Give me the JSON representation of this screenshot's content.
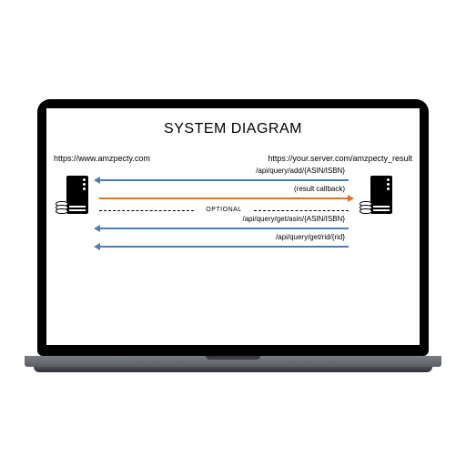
{
  "title": "SYSTEM DIAGRAM",
  "endpoints": {
    "left": "https://www.amzpecty.com",
    "right": "https://your.server.com/amzpecty_result"
  },
  "arrows": {
    "add": {
      "label": "/api/query/add/{ASIN/ISBN}",
      "direction": "left",
      "color": "blue"
    },
    "callback": {
      "label": "(result callback)",
      "direction": "right",
      "color": "orange"
    },
    "getAsin": {
      "label": "/api/query/get/asin/{ASIN/ISBN}",
      "direction": "left",
      "color": "blue"
    },
    "getRid": {
      "label": "/api/query/get/rid/{rid}",
      "direction": "left",
      "color": "blue"
    }
  },
  "optional_label": "OPTIONAL",
  "icons": {
    "server": "server-icon",
    "disk": "disk-icon"
  }
}
